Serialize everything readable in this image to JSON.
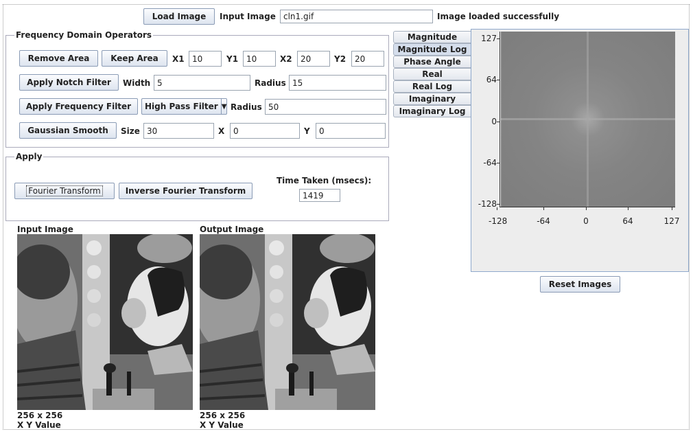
{
  "toolbar": {
    "load_label": "Load Image",
    "input_label": "Input Image",
    "input_value": "cln1.gif",
    "status": "Image loaded successfully"
  },
  "freq_ops": {
    "title": "Frequency Domain Operators",
    "remove_area": "Remove Area",
    "keep_area": "Keep Area",
    "x1_label": "X1",
    "x1_value": "10",
    "y1_label": "Y1",
    "y1_value": "10",
    "x2_label": "X2",
    "x2_value": "20",
    "y2_label": "Y2",
    "y2_value": "20",
    "notch_label": "Apply Notch Filter",
    "width_label": "Width",
    "width_value": "5",
    "radius_label": "Radius",
    "radius_value": "15",
    "freq_filter_label": "Apply Frequency Filter",
    "filter_type": "High Pass Filter",
    "radius2_label": "Radius",
    "radius2_value": "50",
    "gauss_label": "Gaussian Smooth",
    "size_label": "Size",
    "size_value": "30",
    "x_label": "X",
    "x_value": "0",
    "y_label": "Y",
    "y_value": "0"
  },
  "apply": {
    "title": "Apply",
    "fourier": "Fourier Transform",
    "inverse": "Inverse Fourier Transform",
    "time_label": "Time Taken (msecs):",
    "time_value": "1419"
  },
  "images": {
    "input_title": "Input Image",
    "output_title": "Output Image",
    "input_size": "256 x 256",
    "output_size": "256 x 256",
    "input_xy": "X  Y  Value",
    "output_xy": "X  Y  Value"
  },
  "tabs": [
    {
      "label": "Magnitude"
    },
    {
      "label": "Magnitude Log"
    },
    {
      "label": "Phase Angle"
    },
    {
      "label": "Real"
    },
    {
      "label": "Real Log"
    },
    {
      "label": "Imaginary"
    },
    {
      "label": "Imaginary Log"
    }
  ],
  "selected_tab": "Magnitude Log",
  "plot": {
    "y_ticks": [
      "127",
      "64",
      "0",
      "-64",
      "-128"
    ],
    "x_ticks": [
      "-128",
      "-64",
      "0",
      "64",
      "127"
    ]
  },
  "reset_label": "Reset Images",
  "colors": {
    "button_border": "#8a9bb5",
    "tab_selected": "#d5deec",
    "panel_border": "#8fa9cc"
  }
}
